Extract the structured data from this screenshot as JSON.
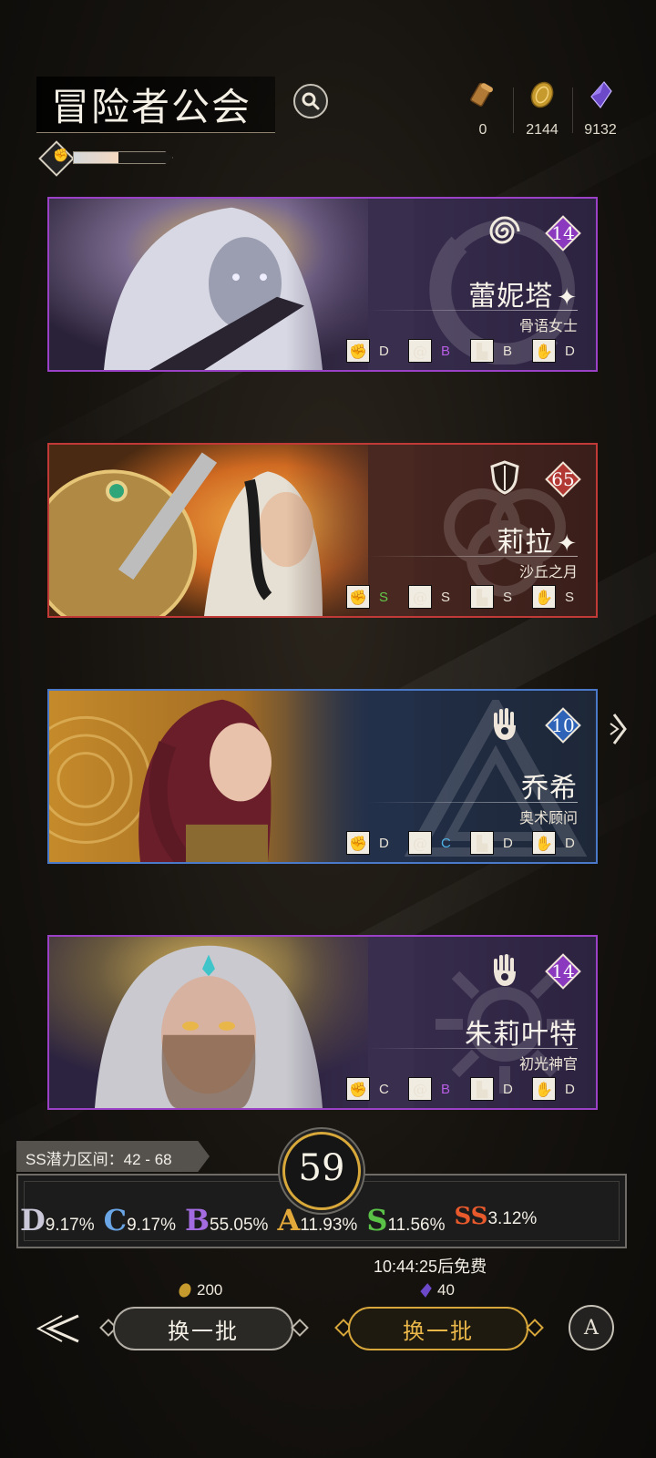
{
  "header": {
    "title": "冒险者公会",
    "rank_icon": "shield-fist-icon",
    "rank_progress": 0.45,
    "currencies": [
      {
        "icon": "scroll-icon",
        "value": "0"
      },
      {
        "icon": "gold-coin-icon",
        "value": "2144"
      },
      {
        "icon": "purple-crystal-icon",
        "value": "9132"
      }
    ]
  },
  "heroes": [
    {
      "name": "蕾妮塔",
      "title": "骨语女士",
      "level": "14",
      "rarity_color": "#9a41c7",
      "class_icon": "spiral-icon",
      "stats": [
        {
          "icon": "fist-icon",
          "grade": "D",
          "color": "#e8e2d6"
        },
        {
          "icon": "swirl-icon",
          "grade": "B",
          "color": "#b75ee4"
        },
        {
          "icon": "boot-icon",
          "grade": "B",
          "color": "#e8e2d6"
        },
        {
          "icon": "flame-hand-icon",
          "grade": "D",
          "color": "#e8e2d6"
        }
      ]
    },
    {
      "name": "莉拉",
      "title": "沙丘之月",
      "level": "65",
      "rarity_color": "#c23a38",
      "class_icon": "shield-icon",
      "stats": [
        {
          "icon": "fist-icon",
          "grade": "S",
          "color": "#62c94a"
        },
        {
          "icon": "swirl-icon",
          "grade": "S",
          "color": "#e8e2d6"
        },
        {
          "icon": "boot-icon",
          "grade": "S",
          "color": "#e8e2d6"
        },
        {
          "icon": "flame-hand-icon",
          "grade": "S",
          "color": "#e8e2d6"
        }
      ]
    },
    {
      "name": "乔希",
      "title": "奥术顾问",
      "level": "10",
      "rarity_color": "#4a79c9",
      "class_icon": "hand-icon",
      "stats": [
        {
          "icon": "fist-icon",
          "grade": "D",
          "color": "#e8e2d6"
        },
        {
          "icon": "swirl-icon",
          "grade": "C",
          "color": "#4fb1e3"
        },
        {
          "icon": "boot-icon",
          "grade": "D",
          "color": "#e8e2d6"
        },
        {
          "icon": "flame-hand-icon",
          "grade": "D",
          "color": "#e8e2d6"
        }
      ]
    },
    {
      "name": "朱莉叶特",
      "title": "初光神官",
      "level": "14",
      "rarity_color": "#9a41c7",
      "class_icon": "hand-icon",
      "stats": [
        {
          "icon": "fist-icon",
          "grade": "C",
          "color": "#e8e2d6"
        },
        {
          "icon": "swirl-icon",
          "grade": "B",
          "color": "#b75ee4"
        },
        {
          "icon": "boot-icon",
          "grade": "D",
          "color": "#e8e2d6"
        },
        {
          "icon": "flame-hand-icon",
          "grade": "D",
          "color": "#e8e2d6"
        }
      ]
    }
  ],
  "potential": {
    "range_label": "SS潜力区间：42 - 68",
    "level": "59",
    "rates": [
      {
        "grade": "D",
        "percent": "9.17%",
        "color": "#c9c7d8"
      },
      {
        "grade": "C",
        "percent": "9.17%",
        "color": "#6aa6e6"
      },
      {
        "grade": "B",
        "percent": "55.05%",
        "color": "#a36be0"
      },
      {
        "grade": "A",
        "percent": "11.93%",
        "color": "#e3a83a"
      },
      {
        "grade": "S",
        "percent": "11.56%",
        "color": "#5ac247"
      },
      {
        "grade": "SS",
        "percent": "3.12%",
        "color": "#e85a2c"
      }
    ]
  },
  "actions": {
    "timer_text": "10:44:25后免费",
    "refresh_gold": {
      "label": "换一批",
      "cost": "200",
      "cost_icon": "gold-coin-icon"
    },
    "refresh_crystal": {
      "label": "换一批",
      "cost": "40",
      "cost_icon": "purple-crystal-icon"
    },
    "auto_label": "A"
  }
}
